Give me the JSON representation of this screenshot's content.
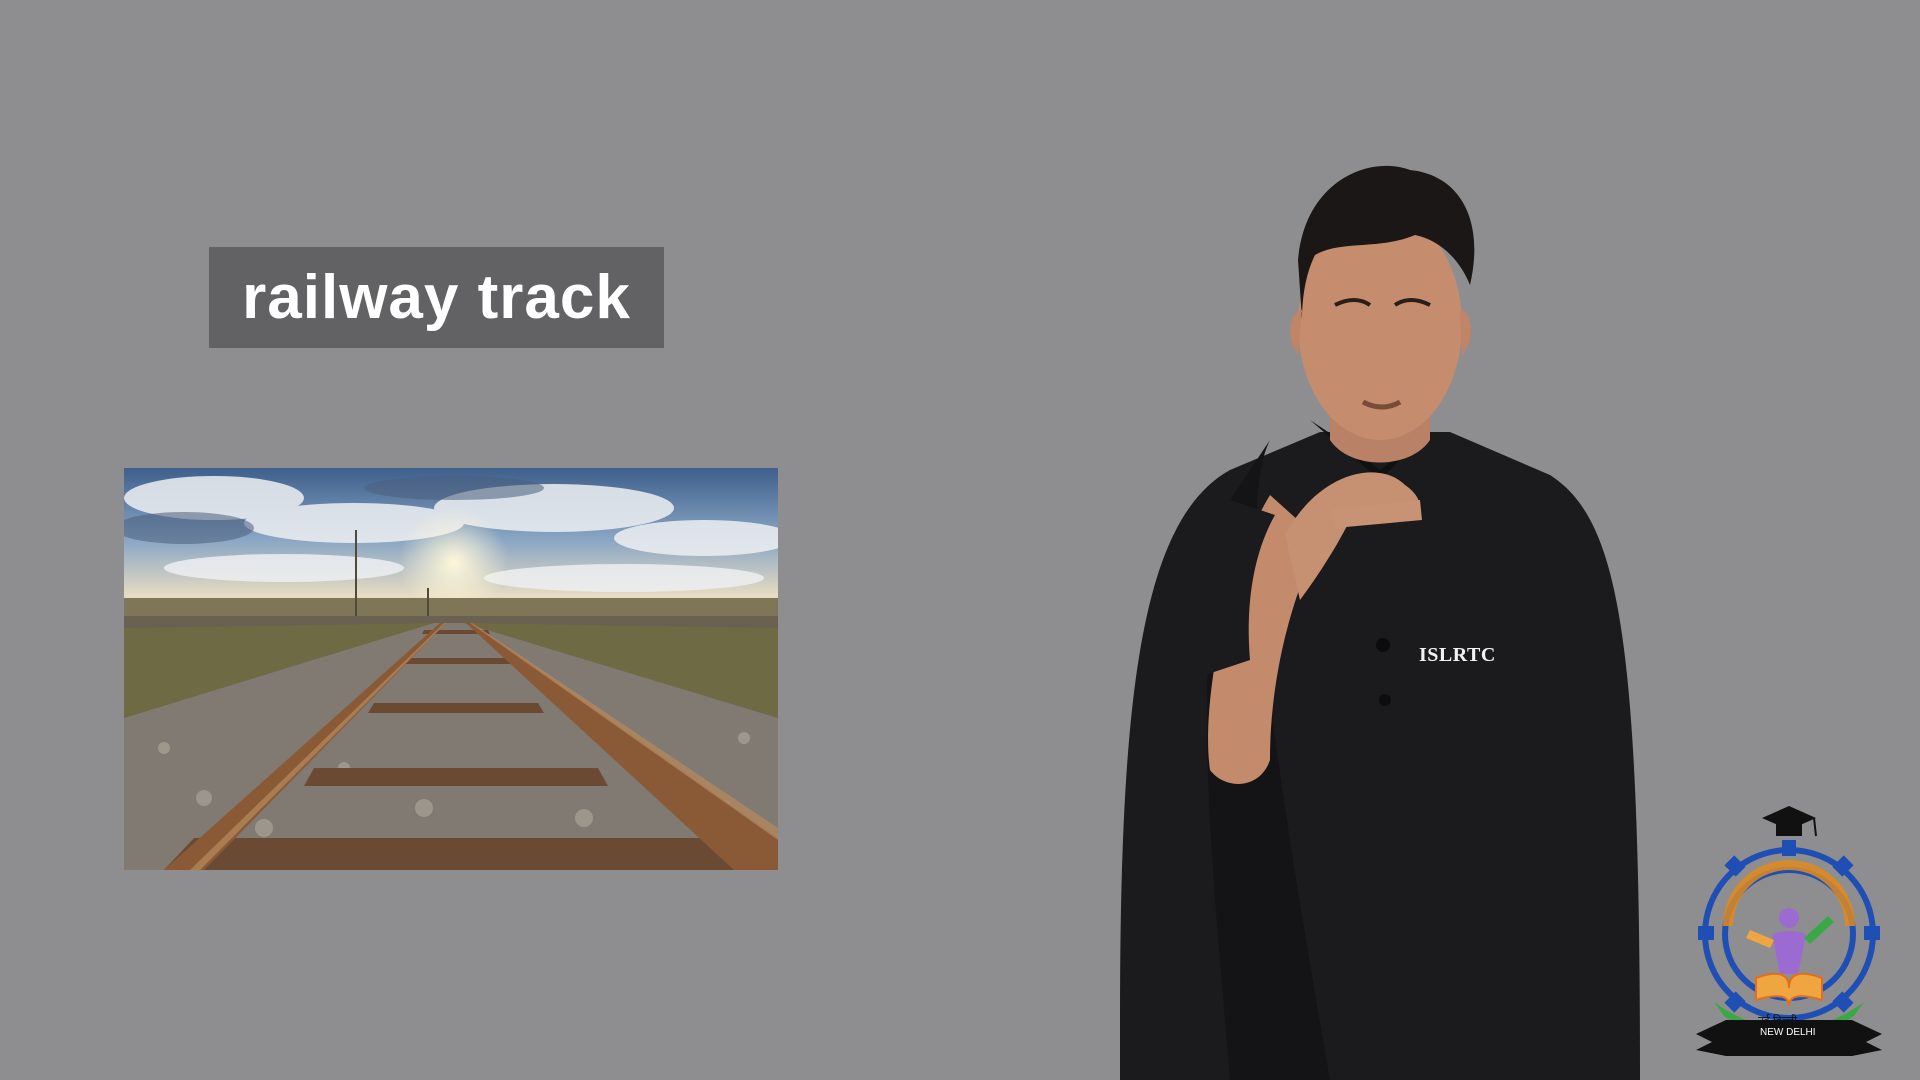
{
  "caption": {
    "word": "railway track"
  },
  "photo": {
    "subject": "railway-track-photo"
  },
  "presenter": {
    "shirt_logo": "ISLRTC"
  },
  "emblem": {
    "city_hindi": "नई दिल्ली",
    "city_english": "NEW DELHI"
  },
  "colors": {
    "background": "#8e8e90",
    "caption_box": "#626264",
    "caption_text": "#ffffff",
    "shirt": "#1b1b1d",
    "emblem_gear": "#1f4fb5",
    "emblem_arc": "#3aa845"
  }
}
